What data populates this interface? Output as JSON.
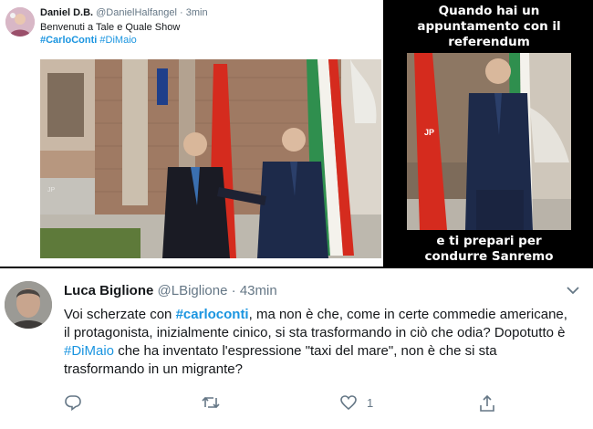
{
  "tweet_top": {
    "display_name": "Daniel D.B.",
    "handle": "@DanielHalfangel",
    "separator": "·",
    "time": "3min",
    "text": "Benvenuti a Tale e Quale Show",
    "hashtag_1": "#CarloConti",
    "hashtag_2": "#DiMaio",
    "photo_overlay_text": "JP"
  },
  "meme": {
    "caption_top_line1": "Quando hai un",
    "caption_top_line2": "appuntamento con il",
    "caption_top_line3": "referendum",
    "caption_bottom_line1": "e ti prepari per",
    "caption_bottom_line2": "condurre Sanremo",
    "flag_label": "JP"
  },
  "tweet_main": {
    "display_name": "Luca Biglione",
    "handle": "@LBiglione",
    "separator": "·",
    "time": "43min",
    "body_1": "Voi scherzate con ",
    "hashtag_1": "#carloconti",
    "body_2": ", ma non è che, come in certe commedie americane, il protagonista, inizialmente cinico, si sta trasformando in ciò che odia? Dopotutto è ",
    "hashtag_2": "#DiMaio",
    "body_3": " che ha  inventato l'espressione \"taxi del mare\", non è  che si sta trasformando in un migrante?",
    "like_count": "1",
    "icons": [
      "reply-icon",
      "retweet-icon",
      "like-icon",
      "share-icon",
      "chevron-down-icon"
    ]
  },
  "colors": {
    "link_blue": "#1b95e0",
    "text_dark": "#14171a",
    "text_muted": "#657786",
    "italy_green": "#2f8f4e",
    "china_red": "#d52b1e"
  }
}
